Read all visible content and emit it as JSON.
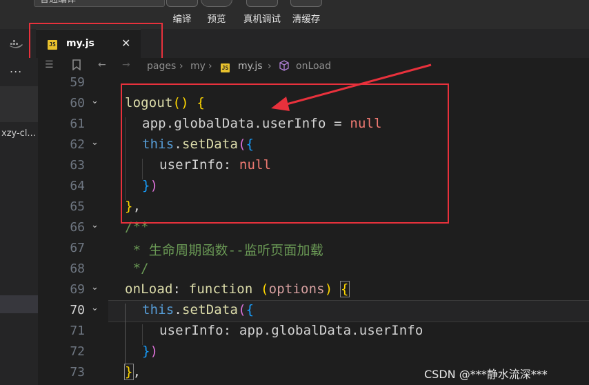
{
  "toolbar": {
    "compile_mode": "普通编译",
    "buttons": [
      {
        "label": "编译",
        "icon": "compile-icon"
      },
      {
        "label": "预览",
        "icon": "preview-icon"
      },
      {
        "label": "真机调试",
        "icon": "debug-icon"
      },
      {
        "label": "清缓存",
        "icon": "clear-cache-icon"
      }
    ]
  },
  "tab": {
    "badge": "JS",
    "label": "my.js",
    "close": "✕"
  },
  "sidebar": {
    "more": "...",
    "project": "xzy-cl..."
  },
  "breadcrumb": {
    "items": [
      "pages",
      "my",
      "my.js",
      "onLoad"
    ],
    "separator": "›"
  },
  "editor": {
    "active_line": 70,
    "lines": [
      {
        "n": 59,
        "code": ""
      },
      {
        "n": 60,
        "code": "logout() {"
      },
      {
        "n": 61,
        "code": "  app.globalData.userInfo = null"
      },
      {
        "n": 62,
        "code": "  this.setData({"
      },
      {
        "n": 63,
        "code": "    userInfo: null"
      },
      {
        "n": 64,
        "code": "  })"
      },
      {
        "n": 65,
        "code": "},"
      },
      {
        "n": 66,
        "code": "/**"
      },
      {
        "n": 67,
        "code": " * 生命周期函数--监听页面加载"
      },
      {
        "n": 68,
        "code": " */"
      },
      {
        "n": 69,
        "code": "onLoad: function (options) {"
      },
      {
        "n": 70,
        "code": "  this.setData({"
      },
      {
        "n": 71,
        "code": "    userInfo: app.globalData.userInfo"
      },
      {
        "n": 72,
        "code": "  })"
      },
      {
        "n": 73,
        "code": "},"
      }
    ]
  },
  "tokens": {
    "l60": [
      "logout",
      "(",
      ")",
      " ",
      "{"
    ],
    "l61": [
      "app",
      ".",
      "globalData",
      ".",
      "userInfo",
      " = ",
      "null"
    ],
    "l62": [
      "this",
      ".",
      "setData",
      "(",
      "{"
    ],
    "l63": [
      "userInfo",
      ": ",
      "null"
    ],
    "l64": [
      "}",
      ")"
    ],
    "l65": [
      "}",
      ","
    ],
    "l66": [
      "/**"
    ],
    "l67": [
      " * 生命周期函数--监听页面加载"
    ],
    "l68": [
      " */"
    ],
    "l69": [
      "onLoad",
      ": ",
      "function",
      " ",
      "(",
      "options",
      ")",
      " ",
      "{"
    ],
    "l70": [
      "this",
      ".",
      "setData",
      "(",
      "{"
    ],
    "l71": [
      "userInfo",
      ": ",
      "app",
      ".",
      "globalData",
      ".",
      "userInfo"
    ],
    "l72": [
      "}",
      ")"
    ],
    "l73": [
      "}",
      ","
    ]
  },
  "watermark": "CSDN @***静水流深***",
  "colors": {
    "highlight": "#e8313c",
    "js_badge": "#e8c12d"
  }
}
